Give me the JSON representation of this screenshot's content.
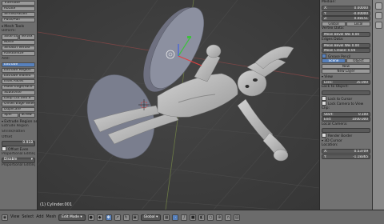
{
  "left_panel": {
    "transform_buttons": [
      "Translate",
      "Rotate",
      "Shrink/Fatten",
      "Push/Pull"
    ],
    "mesh_tools_header": "Mesh Tools",
    "deform_label": "Deform:",
    "slide_buttons": [
      "Slide Ed",
      "Vertex"
    ],
    "deform_buttons": [
      "Noise",
      "Smooth Vertex",
      "Randomize"
    ],
    "add_label": "Add:",
    "add_buttons": [
      "Extrude",
      "Extrude Region",
      "Extrude Individ",
      "Inset Faces",
      "Make Edge/Face",
      "Subdivide",
      "Loop Cut and S",
      "Offset Edge Slide",
      "Duplicate"
    ],
    "spin_screw": [
      "Spin",
      "Screw"
    ],
    "operator_header": "Extrude Region an",
    "operator_items": [
      "Extrude Region",
      "Shrink/Fatten"
    ],
    "offset_label": "Offset",
    "offset_value": "0.918",
    "offset_even": "Offset Even",
    "proportional_label": "Proportional Editing",
    "proportional_value": "Disable",
    "falloff_label": "Proportional Editing F"
  },
  "viewport": {
    "status": "(1) Cylinder.001"
  },
  "right_panel": {
    "median_header": "Median:",
    "x_label": "X:",
    "x_value": "0.00000",
    "y_label": "Y:",
    "y_value": "-0.00000",
    "z_label": "Z:",
    "z_value": "0.08151",
    "coord_buttons": [
      "Global",
      "Local"
    ],
    "vertex_data_header": "Vertex Data:",
    "mean_bevel_weight_1": "Mean Bevel Wei 0.00",
    "edges_data_header": "Edges Data:",
    "mean_bevel_weight_2": "Mean Bevel Wei 0.00",
    "mean_crease": "Mean Crease:   0.00",
    "grease_pencil_label": "Grease Pencil",
    "gp_tabs": [
      "Scene",
      "Object"
    ],
    "gp_new": "New",
    "gp_new_layer": "New Layer",
    "view_header": "View",
    "lens_label": "Lens:",
    "lens_value": "35.000",
    "lock_to_object": "Lock to Object:",
    "lock_to_cursor": "Lock to Cursor",
    "lock_camera": "Lock Camera to View",
    "clip_header": "Clip:",
    "clip_start_label": "Start:",
    "clip_start_value": "0.100",
    "clip_end_label": "End:",
    "clip_end_value": "1000.000",
    "local_camera": "Local Camera:",
    "render_border": "Render Border",
    "cursor_header": "3D Cursor",
    "location_label": "Location:",
    "loc_x_label": "X:",
    "loc_x_value": "0.53709",
    "loc_y_label": "Y:",
    "loc_y_value": "-1.18365"
  },
  "bottom_bar": {
    "menus": [
      "View",
      "Select",
      "Add",
      "Mesh"
    ],
    "mode": "Edit Mode",
    "orientation": "Global"
  },
  "colors": {
    "accent": "#5781bd",
    "viewport_bg": "#3b3b3b",
    "panel_bg": "#727272",
    "mesh": "#b8b8b8",
    "disc": "#8c90a0"
  }
}
